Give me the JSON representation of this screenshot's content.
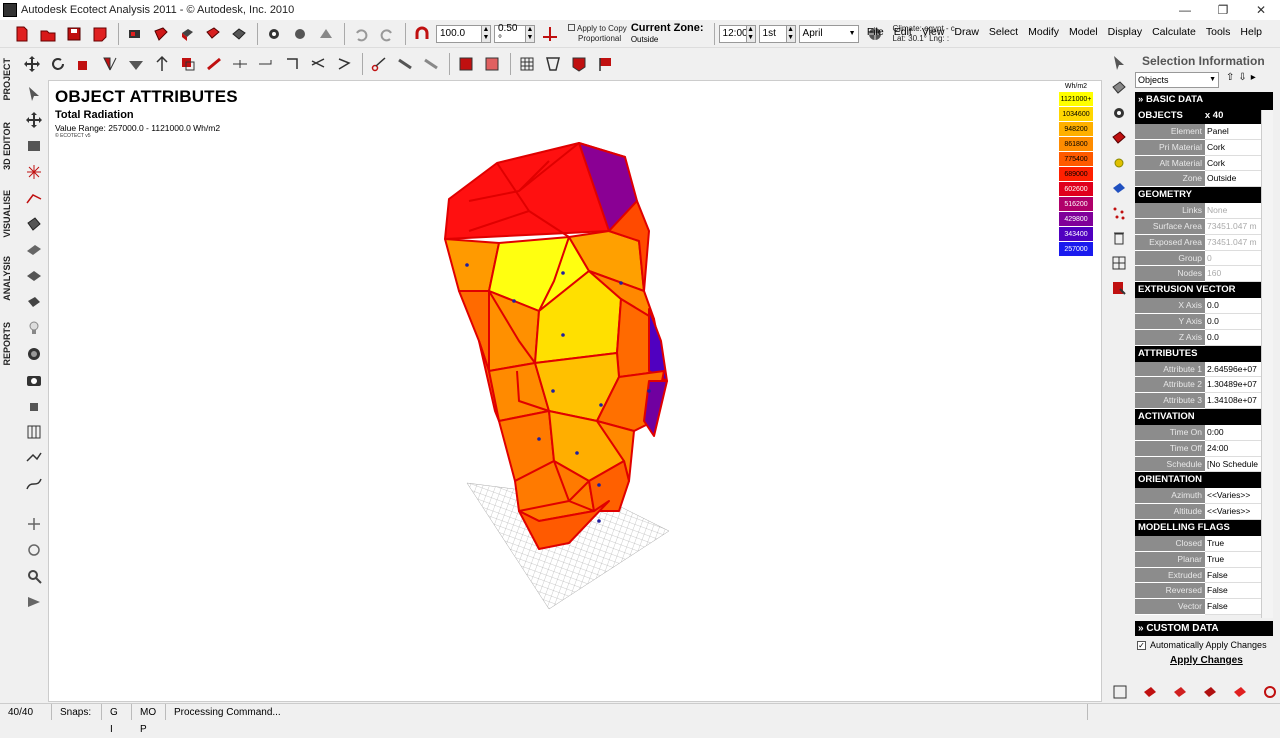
{
  "window": {
    "title": "Autodesk Ecotect Analysis 2011 - © Autodesk, Inc. 2010"
  },
  "toolbar": {
    "scale_value": "100.0",
    "grid_value": "0.50 °",
    "apply_copy": "Apply to Copy",
    "proportional": "Proportional",
    "current_zone_label": "Current Zone:",
    "current_zone_value": "Outside",
    "time_value": "12:00",
    "day_value": "1st",
    "month_value": "April",
    "climate_line1": "Climate: egypt - c",
    "climate_line2": "Lat: 30.1°   Lng: :"
  },
  "menu": [
    "File",
    "Edit",
    "View",
    "Draw",
    "Select",
    "Modify",
    "Model",
    "Display",
    "Calculate",
    "Tools",
    "Help"
  ],
  "left_tabs": [
    "PROJECT",
    "3D EDITOR",
    "VISUALISE",
    "ANALYSIS",
    "REPORTS"
  ],
  "viewport": {
    "title": "OBJECT ATTRIBUTES",
    "subtitle": "Total Radiation",
    "range": "Value Range: 257000.0 - 1121000.0 Wh/m2",
    "logo": "© ECOTECT v5"
  },
  "legend": {
    "unit": "Wh/m2",
    "items": [
      {
        "label": "1121000+",
        "color": "#ffff00"
      },
      {
        "label": "1034600",
        "color": "#ffd700"
      },
      {
        "label": "948200",
        "color": "#ffb000"
      },
      {
        "label": "861800",
        "color": "#ff8c00"
      },
      {
        "label": "775400",
        "color": "#ff5a00"
      },
      {
        "label": "689000",
        "color": "#ff2000"
      },
      {
        "label": "602600",
        "color": "#e0001c"
      },
      {
        "label": "516200",
        "color": "#b0006a"
      },
      {
        "label": "429800",
        "color": "#80009a"
      },
      {
        "label": "343400",
        "color": "#5000c0"
      },
      {
        "label": "257000",
        "color": "#1a1aee"
      }
    ]
  },
  "selection_panel": {
    "title": "Selection Information",
    "combo": "Objects",
    "sections": [
      {
        "header": "BASIC DATA",
        "collapsible": true,
        "rows": []
      },
      {
        "header": "OBJECTS",
        "header_value": "x 40",
        "rows": [
          {
            "k": "Element",
            "v": "Panel"
          },
          {
            "k": "Pri Material",
            "v": "Cork"
          },
          {
            "k": "Alt Material",
            "v": "Cork"
          },
          {
            "k": "Zone",
            "v": "Outside"
          }
        ]
      },
      {
        "header": "GEOMETRY",
        "rows": [
          {
            "k": "Links",
            "v": "None",
            "dim": true
          },
          {
            "k": "Surface Area",
            "v": "73451.047 m",
            "dim": true
          },
          {
            "k": "Exposed Area",
            "v": "73451.047 m",
            "dim": true
          },
          {
            "k": "Group",
            "v": "0",
            "dim": true
          },
          {
            "k": "Nodes",
            "v": "160",
            "dim": true
          }
        ]
      },
      {
        "header": "EXTRUSION VECTOR",
        "rows": [
          {
            "k": "X Axis",
            "v": "0.0"
          },
          {
            "k": "Y Axis",
            "v": "0.0"
          },
          {
            "k": "Z Axis",
            "v": "0.0"
          }
        ]
      },
      {
        "header": "ATTRIBUTES",
        "rows": [
          {
            "k": "Attribute 1",
            "v": "2.64596e+07"
          },
          {
            "k": "Attribute 2",
            "v": "1.30489e+07"
          },
          {
            "k": "Attribute 3",
            "v": "1.34108e+07"
          }
        ]
      },
      {
        "header": "ACTIVATION",
        "rows": [
          {
            "k": "Time On",
            "v": "0:00"
          },
          {
            "k": "Time Off",
            "v": "24:00"
          },
          {
            "k": "Schedule",
            "v": "[No Schedule"
          }
        ]
      },
      {
        "header": "ORIENTATION",
        "rows": [
          {
            "k": "Azimuth",
            "v": "<<Varies>>"
          },
          {
            "k": "Altitude",
            "v": "<<Varies>>"
          }
        ]
      },
      {
        "header": "MODELLING FLAGS",
        "rows": [
          {
            "k": "Closed",
            "v": "True"
          },
          {
            "k": "Planar",
            "v": "True"
          },
          {
            "k": "Extruded",
            "v": "False"
          },
          {
            "k": "Reversed",
            "v": "False"
          },
          {
            "k": "Vector",
            "v": "False"
          }
        ]
      }
    ],
    "custom_data": "» CUSTOM DATA",
    "auto_apply": "Automatically Apply Changes",
    "apply_button": "Apply Changes"
  },
  "status": {
    "count": "40/40",
    "snaps": "Snaps:",
    "snap_flags": "G I",
    "mode_flags": "MO P",
    "message": "Processing Command..."
  }
}
